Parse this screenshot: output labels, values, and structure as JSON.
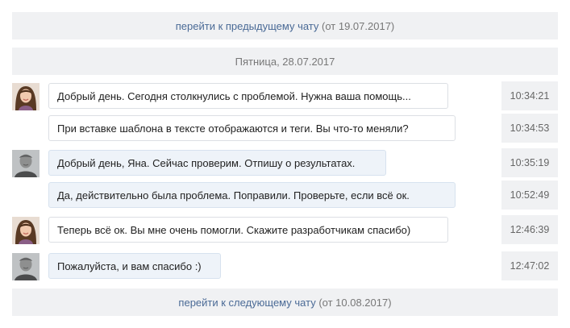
{
  "nav": {
    "prev_link": "перейти к предыдущему чату",
    "prev_date": "(от 19.07.2017)",
    "next_link": "перейти к следующему чату",
    "next_date": "(от 10.08.2017)"
  },
  "date_header": "Пятница, 28.07.2017",
  "messages": [
    {
      "author": "client",
      "avatar": "female-avatar",
      "text": "Добрый день. Сегодня столкнулись с проблемой. Нужна ваша помощь...",
      "time": "10:34:21"
    },
    {
      "author": "client",
      "avatar": "",
      "text": "При вставке шаблона в тексте отображаются и теги. Вы что-то меняли?",
      "time": "10:34:53"
    },
    {
      "author": "operator",
      "avatar": "male-avatar",
      "text": "Добрый день, Яна. Сейчас проверим. Отпишу о результатах.",
      "time": "10:35:19"
    },
    {
      "author": "operator",
      "avatar": "",
      "text": "Да, действительно была проблема. Поправили. Проверьте, если всё ок.",
      "time": "10:52:49"
    },
    {
      "author": "client",
      "avatar": "female-avatar",
      "text": "Теперь всё ок. Вы мне очень помогли. Скажите разработчикам спасибо)",
      "time": "12:46:39"
    },
    {
      "author": "operator",
      "avatar": "male-avatar",
      "text": "Пожалуйста, и вам спасибо :)",
      "time": "12:47:02"
    }
  ],
  "colors": {
    "bar_bg": "#f0f1f3",
    "link": "#4a6a96",
    "operator_bubble": "#eef3f9",
    "client_bubble": "#ffffff"
  }
}
